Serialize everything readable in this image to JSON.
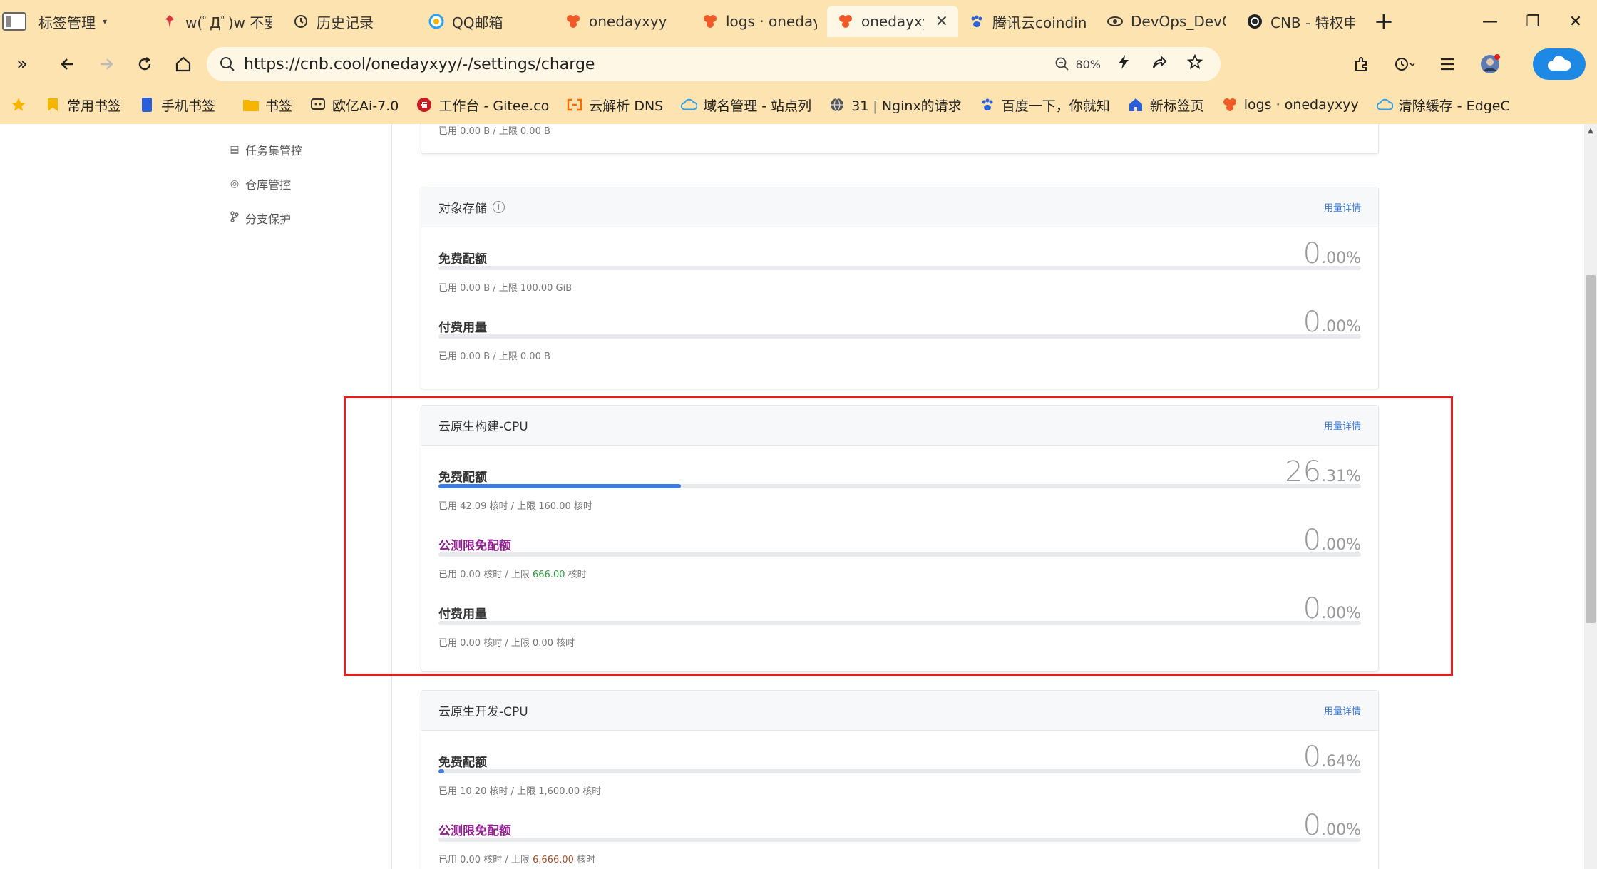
{
  "browser": {
    "tabs": [
      {
        "label": "标签管理",
        "icon": "tab-manager-icon",
        "color": "#555555",
        "caret": "▾"
      },
      {
        "label": "w(ﾟДﾟ)w 不要",
        "icon": "pin-icon",
        "color": "#d9363e"
      },
      {
        "label": "历史记录",
        "icon": "history-icon",
        "color": "#333333"
      },
      {
        "label": "QQ邮箱",
        "icon": "qq-mail-icon",
        "color": "#2aa2f0"
      },
      {
        "label": "onedayxyy",
        "icon": "cnb-icon",
        "color": "#f05a28"
      },
      {
        "label": "logs · oneday",
        "icon": "cnb-icon",
        "color": "#f05a28"
      },
      {
        "label": "onedayxyy",
        "icon": "cnb-icon",
        "color": "#f05a28",
        "active": true,
        "close": "✕"
      },
      {
        "label": "腾讯云coindin",
        "icon": "paw-icon",
        "color": "#2b5fd9"
      },
      {
        "label": "DevOps_DevC",
        "icon": "eye-icon",
        "color": "#333333"
      },
      {
        "label": "CNB - 特权申",
        "icon": "cnb-dark-icon",
        "color": "#222222"
      }
    ],
    "new_tab": "+",
    "window": {
      "minimize": "—",
      "restore": "❐",
      "close": "✕"
    },
    "url": "https://cnb.cool/onedayxyy/-/settings/charge",
    "zoom": "80%",
    "bookmarks": [
      {
        "label": "常用书签",
        "icon": "bookmark-icon",
        "color": "#f4b400"
      },
      {
        "label": "手机书签",
        "icon": "phone-icon",
        "color": "#2b5fd9"
      },
      {
        "label": "书签",
        "icon": "folder-icon",
        "color": "#f4b400"
      },
      {
        "label": "欧亿Ai-7.0",
        "icon": "chat-icon",
        "color": "#333333"
      },
      {
        "label": "工作台 - Gitee.co",
        "icon": "gitee-icon",
        "color": "#c71d23"
      },
      {
        "label": "云解析 DNS",
        "icon": "aliyun-icon",
        "color": "#ff6a00"
      },
      {
        "label": "域名管理 - 站点列",
        "icon": "cloud-icon",
        "color": "#2aa2f0"
      },
      {
        "label": "31 | Nginx的请求",
        "icon": "globe-icon",
        "color": "#444444"
      },
      {
        "label": "百度一下，你就知",
        "icon": "paw-icon",
        "color": "#2b5fd9"
      },
      {
        "label": "新标签页",
        "icon": "home-icon",
        "color": "#2b5fd9"
      },
      {
        "label": "logs · onedayxyy",
        "icon": "cnb-icon",
        "color": "#f05a28"
      },
      {
        "label": "清除缓存 - EdgeC",
        "icon": "cloud-icon",
        "color": "#2aa2f0"
      }
    ]
  },
  "sidebar": {
    "items": [
      {
        "label": "任务集管控",
        "icon": "list-icon"
      },
      {
        "label": "仓库管控",
        "icon": "target-icon"
      },
      {
        "label": "分支保护",
        "icon": "branch-icon"
      }
    ]
  },
  "cards": [
    {
      "id": "prev",
      "title": "",
      "rows": [
        {
          "label": "",
          "meta": "已用 0.00 B / 上限 0.00 B"
        }
      ]
    },
    {
      "id": "object-storage",
      "title": "对象存储",
      "link": "用量详情",
      "rows": [
        {
          "label": "免费配额",
          "pct_int": "0",
          "pct_dec": ".00%",
          "fill": 0,
          "meta": "已用 0.00 B / 上限 100.00 GiB"
        },
        {
          "label": "付费用量",
          "pct_int": "0",
          "pct_dec": ".00%",
          "fill": 0,
          "meta": "已用 0.00 B / 上限 0.00 B"
        }
      ]
    },
    {
      "id": "build-cpu",
      "title": "云原生构建-CPU",
      "link": "用量详情",
      "rows": [
        {
          "label": "免费配额",
          "pct_int": "26",
          "pct_dec": ".31%",
          "fill": 0.2631,
          "meta": "已用 42.09 核时 / 上限 160.00 核时"
        },
        {
          "label": "公测限免配额",
          "beta": true,
          "pct_int": "0",
          "pct_dec": ".00%",
          "fill": 0,
          "meta_pre": "已用 0.00 核时 / 上限 ",
          "meta_num": "666.00",
          "meta_post": " 核时",
          "num_color": "green"
        },
        {
          "label": "付费用量",
          "pct_int": "0",
          "pct_dec": ".00%",
          "fill": 0,
          "meta": "已用 0.00 核时 / 上限 0.00 核时"
        }
      ]
    },
    {
      "id": "dev-cpu",
      "title": "云原生开发-CPU",
      "link": "用量详情",
      "rows": [
        {
          "label": "免费配额",
          "pct_int": "0",
          "pct_dec": ".64%",
          "fill": 0.0064,
          "meta": "已用 10.20 核时 / 上限 1,600.00 核时"
        },
        {
          "label": "公测限免配额",
          "beta": true,
          "pct_int": "0",
          "pct_dec": ".00%",
          "fill": 0,
          "meta_pre": "已用 0.00 核时 / 上限 ",
          "meta_num": "6,666.00",
          "meta_post": " 核时",
          "num_color": "brown"
        }
      ]
    }
  ]
}
